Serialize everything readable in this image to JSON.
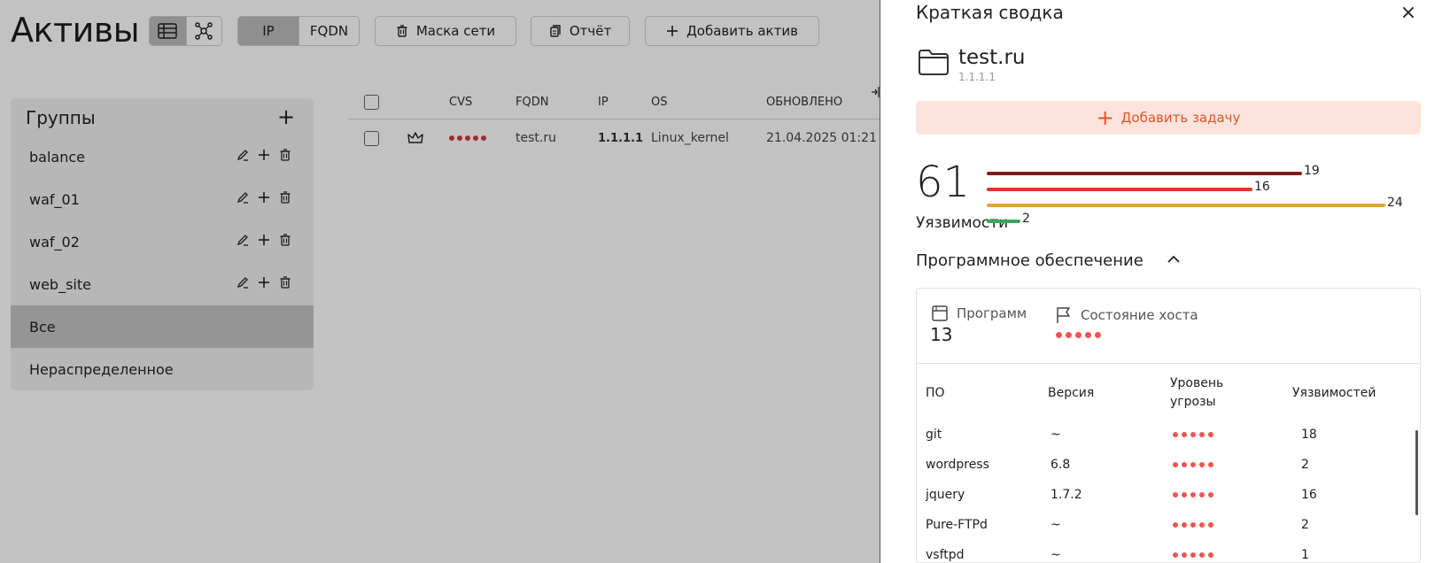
{
  "main": {
    "title": "Активы",
    "type_toggle": {
      "ip": "IP",
      "fqdn": "FQDN"
    },
    "buttons": {
      "mask": "Маска сети",
      "report": "Отчёт",
      "add_asset": "Добавить актив"
    },
    "groups": {
      "title": "Группы",
      "add_symbol": "+",
      "items": [
        {
          "label": "balance"
        },
        {
          "label": "waf_01"
        },
        {
          "label": "waf_02"
        },
        {
          "label": "web_site"
        },
        {
          "label": "Все"
        },
        {
          "label": "Нераспределенное"
        }
      ]
    },
    "table": {
      "headers": {
        "cvs": "CVS",
        "fqdn": "FQDN",
        "ip": "IP",
        "os": "OS",
        "updated": "ОБНОВЛЕНО"
      },
      "rows": [
        {
          "fqdn": "test.ru",
          "ip": "1.1.1.1",
          "os": "Linux_kernel",
          "updated": "21.04.2025 01:21"
        }
      ]
    }
  },
  "panel": {
    "title": "Краткая сводка",
    "close_symbol": "×",
    "asset": {
      "name": "test.ru",
      "ip": "1.1.1.1"
    },
    "add_task": {
      "plus": "+",
      "label": "Добавить задачу"
    },
    "vulns": {
      "total": "61",
      "label": "Уязвимости",
      "levels": [
        {
          "count": 19,
          "color": "#7a1f1f"
        },
        {
          "count": 16,
          "color": "#d63a2f"
        },
        {
          "count": 24,
          "color": "#e3a33a"
        },
        {
          "count": 2,
          "color": "#3aa55d"
        }
      ]
    },
    "software": {
      "title": "Программное обеспечение",
      "programs_label": "Программ",
      "programs_count": "13",
      "host_state_label": "Состояние хоста",
      "columns": {
        "name": "ПО",
        "version": "Версия",
        "threat_line1": "Уровень",
        "threat_line2": "угрозы",
        "vulns": "Уязвимостей"
      },
      "rows": [
        {
          "name": "git",
          "version": "~",
          "vulns": "18"
        },
        {
          "name": "wordpress",
          "version": "6.8",
          "vulns": "2"
        },
        {
          "name": "jquery",
          "version": "1.7.2",
          "vulns": "16"
        },
        {
          "name": "Pure-FTPd",
          "version": "~",
          "vulns": "2"
        },
        {
          "name": "vsftpd",
          "version": "~",
          "vulns": "1"
        }
      ]
    }
  }
}
